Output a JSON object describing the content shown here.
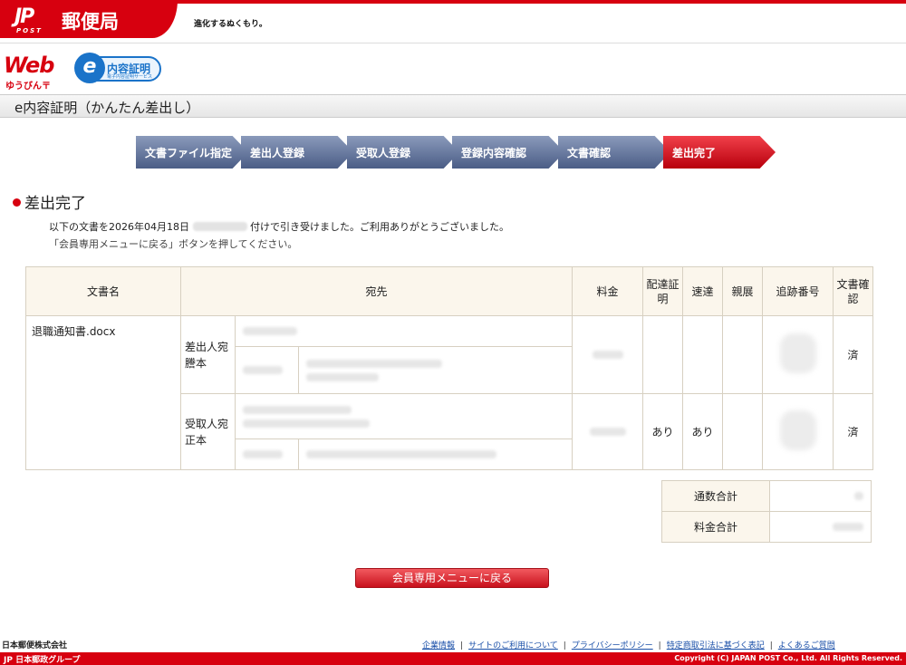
{
  "header": {
    "jp_mark": "JP",
    "post_label": "POST",
    "post_office_name": "郵便局",
    "slogan": "進化するぬくもり。"
  },
  "service": {
    "web_logo": "Web",
    "web_sub": "ゆうびん〒",
    "e_mark": "e",
    "e_name": "内容証明",
    "e_sub": "電子内容証明サービス",
    "page_title": "e内容証明（かんたん差出し）"
  },
  "steps": [
    {
      "label": "文書ファイル指定"
    },
    {
      "label": "差出人登録"
    },
    {
      "label": "受取人登録"
    },
    {
      "label": "登録内容確認"
    },
    {
      "label": "文書確認"
    },
    {
      "label": "差出完了"
    }
  ],
  "completion": {
    "heading": "差出完了",
    "message_prefix": "以下の文書を2026年04月18日",
    "message_suffix": "付けで引き受けました。ご利用ありがとうございました。",
    "instruction": "「会員専用メニューに戻る」ボタンを押してください。"
  },
  "table": {
    "headers": {
      "doc_name": "文書名",
      "destination": "宛先",
      "fee": "料金",
      "delivery_cert": "配達証明",
      "express": "速達",
      "personal": "親展",
      "tracking": "追跡番号",
      "doc_check": "文書確認"
    },
    "doc_name": "退職通知書.docx",
    "rows": [
      {
        "kind": "差出人宛謄本",
        "delivery_cert": "",
        "express": "",
        "personal": "",
        "doc_check": "済"
      },
      {
        "kind": "受取人宛正本",
        "delivery_cert": "あり",
        "express": "あり",
        "personal": "",
        "doc_check": "済"
      }
    ]
  },
  "totals": {
    "count_label": "通数合計",
    "fee_label": "料金合計"
  },
  "return_button": "会員専用メニューに戻る",
  "footer": {
    "company": "日本郵便株式会社",
    "links": [
      "企業情報",
      "サイトのご利用について",
      "プライバシーポリシー",
      "特定商取引法に基づく表記",
      "よくあるご質問"
    ],
    "group": "JP 日本郵政グループ",
    "copyright": "Copyright (C) JAPAN POST Co., Ltd. All Rights Reserved."
  },
  "colors": {
    "brand_red": "#d7000f",
    "step_blue": "#5a6b93",
    "header_beige": "#fbf6ec",
    "link_blue": "#1a4fa8"
  }
}
